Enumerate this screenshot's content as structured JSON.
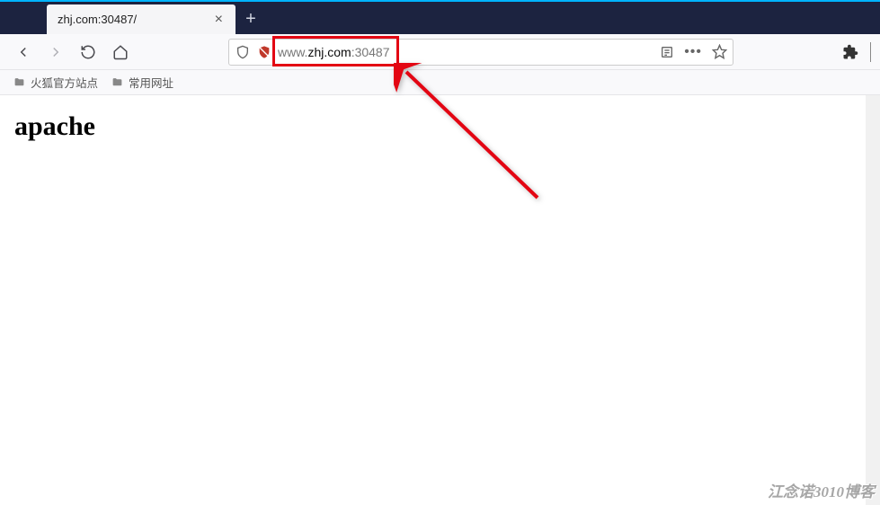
{
  "tab": {
    "title": "zhj.com:30487/",
    "close_glyph": "×"
  },
  "new_tab_glyph": "+",
  "url": {
    "prefix": "www.",
    "domain": "zhj.com",
    "suffix": ":30487"
  },
  "toolbar": {
    "back_icon": "back",
    "forward_icon": "forward",
    "reload_icon": "reload",
    "home_icon": "home",
    "shield_icon": "shield",
    "strike_shield_icon": "shield-off",
    "reader_icon": "reader",
    "dots": "•••",
    "star_icon": "star",
    "puzzle_icon": "extensions"
  },
  "bookmarks": {
    "items": [
      {
        "label": "火狐官方站点"
      },
      {
        "label": "常用网址"
      }
    ]
  },
  "content": {
    "heading": "apache"
  },
  "watermark": "江念诺3010博客"
}
